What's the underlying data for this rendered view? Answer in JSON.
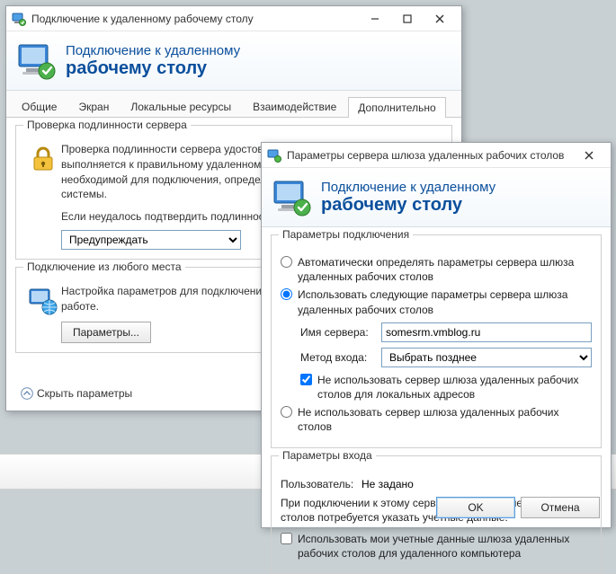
{
  "mainWindow": {
    "title": "Подключение к удаленному рабочему столу",
    "bannerLine1": "Подключение к удаленному",
    "bannerLine2": "рабочему столу",
    "tabs": [
      "Общие",
      "Экран",
      "Локальные ресурсы",
      "Взаимодействие",
      "Дополнительно"
    ],
    "activeTab": 4,
    "auth": {
      "legend": "Проверка подлинности сервера",
      "desc1": "Проверка подлинности сервера удостоверяет, что подключение выполняется к правильному удаленному компьютеру. Строгость проверки, необходимой для подключения, определяется политикой безопасности системы.",
      "desc2": "Если неудалось подтвердить подлинность удаленного компьютера:",
      "selectValue": "Предупреждать"
    },
    "anywhere": {
      "legend": "Подключение из любого места",
      "desc": "Настройка параметров для подключения через шлюз при удаленной работе.",
      "button": "Параметры..."
    },
    "hideParams": "Скрыть параметры"
  },
  "dlg": {
    "title": "Параметры сервера шлюза удаленных рабочих столов",
    "bannerLine1": "Подключение к удаленному",
    "bannerLine2": "рабочему столу",
    "conn": {
      "legend": "Параметры подключения",
      "radioAuto": "Автоматически определять параметры сервера шлюза удаленных рабочих столов",
      "radioUse": "Использовать следующие параметры сервера шлюза удаленных рабочих столов",
      "serverLabel": "Имя сервера:",
      "serverValue": "somesrm.vmblog.ru",
      "methodLabel": "Метод входа:",
      "methodValue": "Выбрать позднее",
      "bypass": "Не использовать сервер шлюза удаленных рабочих столов для локальных адресов",
      "radioNone": "Не использовать сервер шлюза удаленных рабочих столов"
    },
    "login": {
      "legend": "Параметры входа",
      "userLabel": "Пользователь:",
      "userValue": "Не задано",
      "desc": "При подключении к этому серверу шлюза удаленных рабочих столов потребуется указать учетные данные.",
      "shareCreds": "Использовать мои учетные данные шлюза удаленных рабочих столов для удаленного компьютера"
    },
    "ok": "OK",
    "cancel": "Отмена"
  }
}
